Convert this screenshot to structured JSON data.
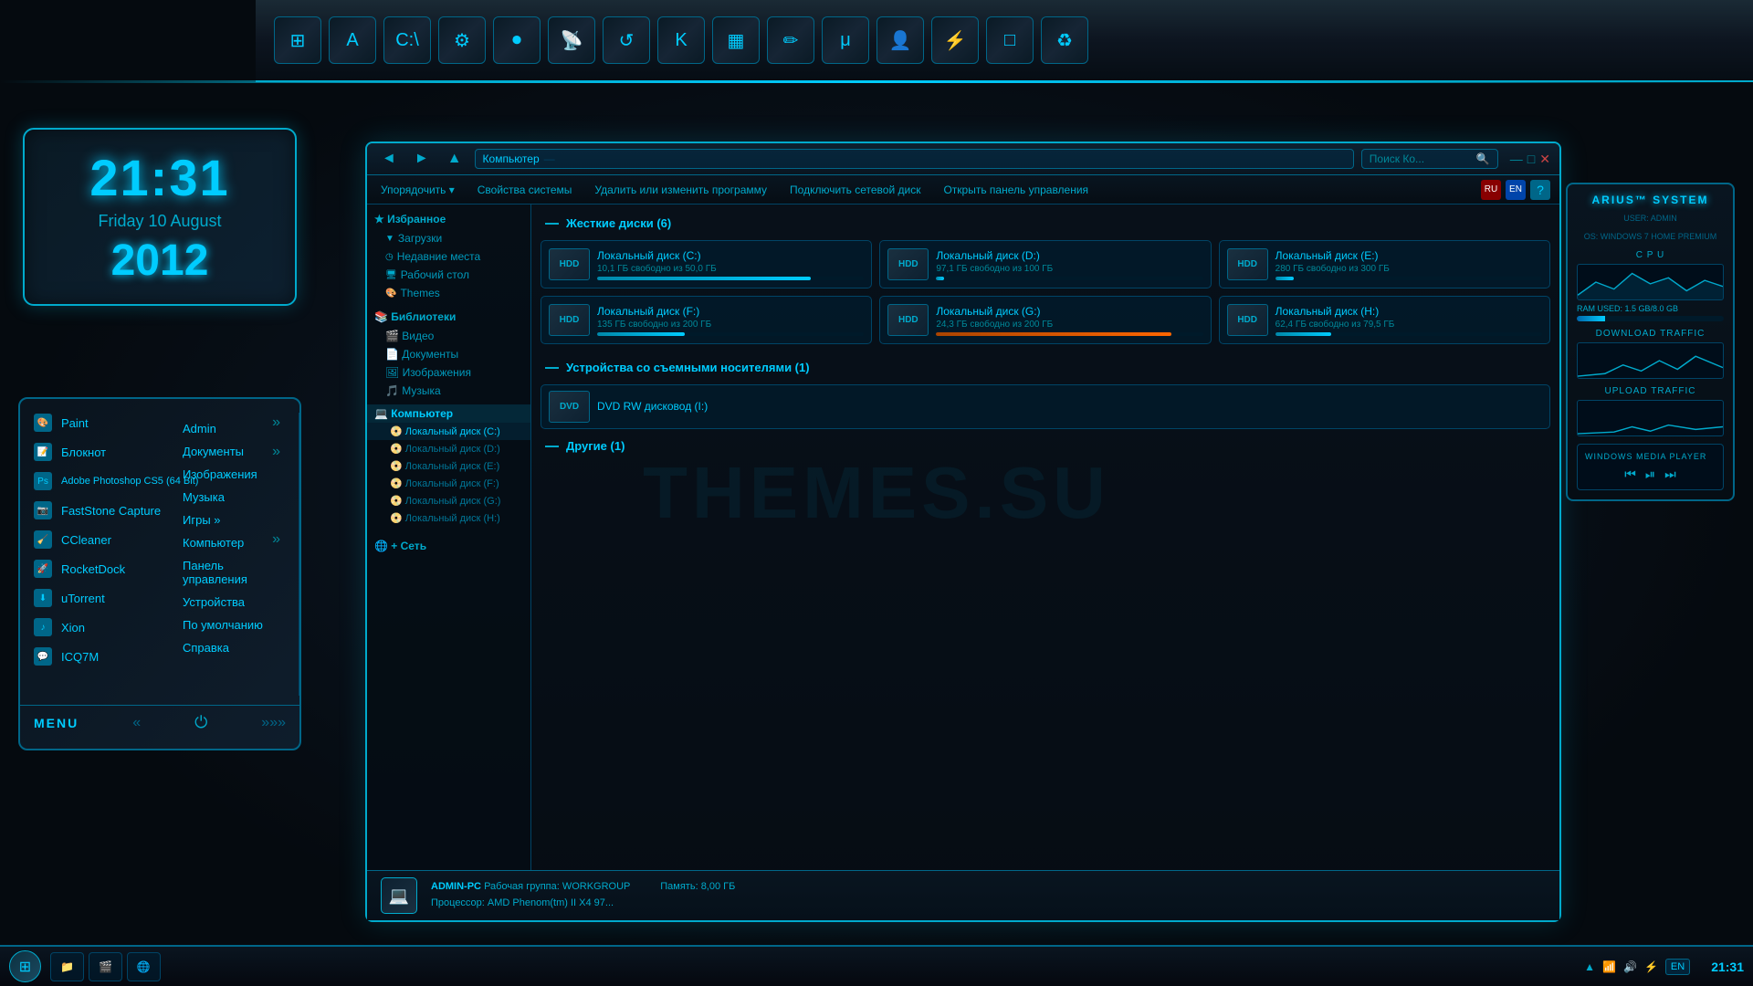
{
  "clock": {
    "time": "21:31",
    "day": "Friday 10 August",
    "year": "2012"
  },
  "toolbar": {
    "icons": [
      "⊞",
      "A",
      "C:\\",
      "⚙",
      "⏺",
      "RSS",
      "↺",
      "K",
      "▦",
      "✏",
      "μ",
      "👤",
      "⚡",
      "□",
      "♻"
    ]
  },
  "fileManager": {
    "title": "Компьютер",
    "addressBar": "Компьютер",
    "searchPlaceholder": "Поиск Ко...",
    "toolbar": {
      "items": [
        "Упорядочить ▾",
        "Свойства системы",
        "Удалить или изменить программу",
        "Подключить сетевой диск",
        "Открыть панель управления"
      ]
    },
    "sidebar": {
      "favorites": {
        "label": "★ Избранное",
        "items": [
          "Загрузки",
          "Недавние места",
          "Рабочий стол",
          "Themes"
        ]
      },
      "libraries": {
        "label": "Библиотеки",
        "items": [
          "Видео",
          "Документы",
          "Изображения",
          "Музыка"
        ]
      },
      "computer": {
        "label": "Компьютер",
        "drives": [
          "Локальный диск (C:)",
          "Локальный диск (D:)",
          "Локальный диск (E:)",
          "Локальный диск (F:)",
          "Локальный диск (G:)",
          "Локальный диск (H:)"
        ]
      },
      "network": {
        "label": "Сеть"
      }
    },
    "sections": {
      "hardDrives": {
        "title": "Жесткие диски (6)",
        "drives": [
          {
            "name": "Локальный диск (C:)",
            "free": "10,1 ГБ свободно из 50,0 ГБ",
            "pct": 80
          },
          {
            "name": "Локальный диск (D:)",
            "free": "97,1 ГБ свободно из 100 ГБ",
            "pct": 3
          },
          {
            "name": "Локальный диск (E:)",
            "free": "280 ГБ свободно из 300 ГБ",
            "pct": 7
          },
          {
            "name": "Локальный диск (F:)",
            "free": "135 ГБ свободно из 200 ГБ",
            "pct": 33
          },
          {
            "name": "Локальный диск (G:)",
            "free": "24,3 ГБ свободно из 200 ГБ",
            "pct": 88
          },
          {
            "name": "Локальный диск (H:)",
            "free": "62,4 ГБ свободно из 79,5 ГБ",
            "pct": 21
          }
        ]
      },
      "removable": {
        "title": "Устройства со съемными носителями (1)",
        "items": [
          {
            "name": "DVD RW дисковод (I:)"
          }
        ]
      },
      "other": {
        "title": "Другие (1)"
      }
    },
    "statusBar": {
      "computer": "ADMIN-PC",
      "workgroup": "Рабочая группа: WORKGROUP",
      "memory": "Память: 8,00 ГБ",
      "processor": "Процессор: AMD Phenom(tm) II X4 97..."
    }
  },
  "leftMenu": {
    "apps": [
      {
        "name": "Paint",
        "hasArrow": true
      },
      {
        "name": "Блокнот",
        "hasArrow": true
      },
      {
        "name": "Adobe Photoshop CS5 (64 Bit)",
        "hasArrow": false
      },
      {
        "name": "FastStone Capture",
        "hasArrow": false
      },
      {
        "name": "CCleaner",
        "hasArrow": true
      },
      {
        "name": "RocketDock",
        "hasArrow": false
      },
      {
        "name": "uTorrent",
        "hasArrow": false
      },
      {
        "name": "Xion",
        "hasArrow": false
      },
      {
        "name": "ICQ7M",
        "hasArrow": false
      }
    ],
    "rightItems": [
      "Admin",
      "Документы",
      "Изображения",
      "Музыка",
      "Игры ▶",
      "Компьютер",
      "Панель управления",
      "Устройства",
      "По умолчанию",
      "Справка"
    ],
    "footer": {
      "menuLabel": "MENU",
      "powerIcon": "⏻"
    }
  },
  "rightPanel": {
    "title": "ARIUS™ SYSTEM",
    "subtitle1": "USER: ADMIN",
    "subtitle2": "OS: WINDOWS 7 HOME PREMIUM",
    "cpu": {
      "label": "C P U",
      "bars": [
        65,
        30,
        80,
        45
      ]
    },
    "ram": {
      "label": "RAM USED: 1.5 GB/8.0 GB",
      "pct": 19
    },
    "download": {
      "label": "DOWNLOAD TRAFFIC"
    },
    "upload": {
      "label": "UPLOAD TRAFFIC"
    },
    "mediaPlayer": {
      "label": "WINDOWS MEDIA PLAYER"
    }
  },
  "taskbar": {
    "startLabel": "⊞",
    "items": [
      "📁",
      "🎬",
      "🌐"
    ],
    "tray": {
      "lang": "EN",
      "time": "21:31"
    }
  },
  "watermark": "THEMES.SU"
}
